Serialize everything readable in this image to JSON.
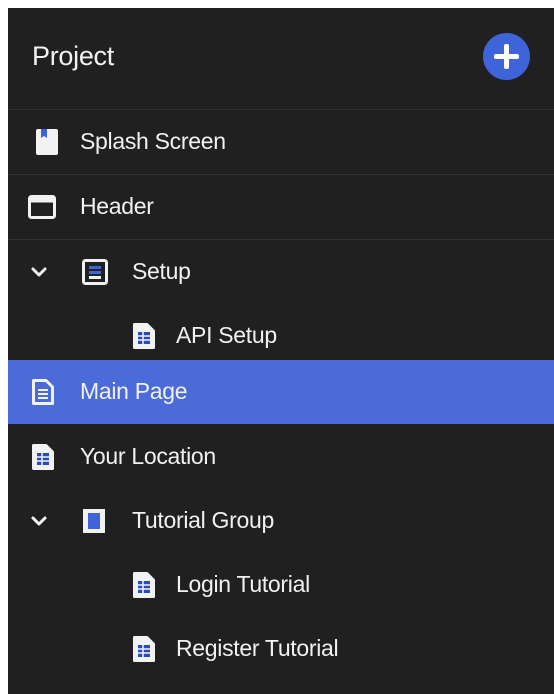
{
  "panel": {
    "title": "Project",
    "add_icon": "plus-circle-icon",
    "accent_color": "#3f63d8",
    "selected_color": "#4a6bd8"
  },
  "tree": [
    {
      "label": "Splash Screen",
      "icon": "splash-screen-icon",
      "depth": 0,
      "expandable": false,
      "selected": false
    },
    {
      "label": "Header",
      "icon": "header-window-icon",
      "depth": 0,
      "expandable": false,
      "selected": false
    },
    {
      "label": "Setup",
      "icon": "setup-module-icon",
      "depth": 0,
      "expandable": true,
      "expanded": true,
      "selected": false
    },
    {
      "label": "API Setup",
      "icon": "page-icon",
      "depth": 1,
      "expandable": false,
      "selected": false
    },
    {
      "label": "Main Page",
      "icon": "page-icon",
      "depth": 0,
      "expandable": false,
      "selected": true
    },
    {
      "label": "Your Location",
      "icon": "page-icon",
      "depth": 0,
      "expandable": false,
      "selected": false
    },
    {
      "label": "Tutorial Group",
      "icon": "group-icon",
      "depth": 0,
      "expandable": true,
      "expanded": true,
      "selected": false
    },
    {
      "label": "Login Tutorial",
      "icon": "page-icon",
      "depth": 1,
      "expandable": false,
      "selected": false
    },
    {
      "label": "Register Tutorial",
      "icon": "page-icon",
      "depth": 1,
      "expandable": false,
      "selected": false
    }
  ]
}
